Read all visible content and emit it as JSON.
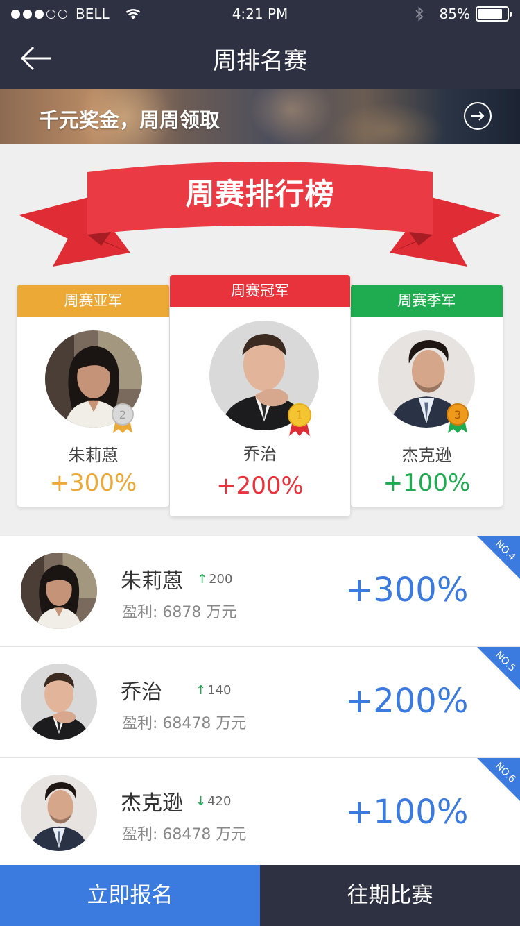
{
  "status_bar": {
    "carrier": "BELL",
    "time": "4:21 PM",
    "battery": "85%",
    "battery_level": 0.85,
    "signal_bars": 3,
    "signal_total": 5
  },
  "nav": {
    "title": "周排名赛",
    "back_icon": "back-arrow-icon"
  },
  "banner": {
    "text": "千元奖金，周周领取",
    "arrow_icon": "arrow-right-circle-icon"
  },
  "ribbon": {
    "title": "周赛排行榜"
  },
  "podium": {
    "first": {
      "label": "周赛冠军",
      "name": "乔治",
      "percent": "+200%",
      "medal": "1",
      "color": "#e8333c"
    },
    "second": {
      "label": "周赛亚军",
      "name": "朱莉蒽",
      "percent": "+300%",
      "medal": "2",
      "color": "#eda935"
    },
    "third": {
      "label": "周赛季军",
      "name": "杰克逊",
      "percent": "+100%",
      "medal": "3",
      "color": "#1fab4f"
    }
  },
  "rankings": [
    {
      "name": "朱莉蒽",
      "direction": "up",
      "change": "200",
      "profit_label": "盈利:",
      "profit": "6878 万元",
      "percent": "+300%",
      "rank": "NO.4"
    },
    {
      "name": "乔治",
      "direction": "up",
      "change": "140",
      "profit_label": "盈利:",
      "profit": "68478 万元",
      "percent": "+200%",
      "rank": "NO.5"
    },
    {
      "name": "杰克逊",
      "direction": "down",
      "change": "420",
      "profit_label": "盈利:",
      "profit": "68478 万元",
      "percent": "+100%",
      "rank": "NO.6"
    }
  ],
  "bottom_bar": {
    "signup": "立即报名",
    "history": "往期比赛"
  },
  "colors": {
    "header_bg": "#2d3142",
    "accent_blue": "#3b7be0",
    "gold": "#eda935",
    "red": "#e8333c",
    "green": "#1fab4f",
    "up_arrow": "#1fab4f"
  }
}
